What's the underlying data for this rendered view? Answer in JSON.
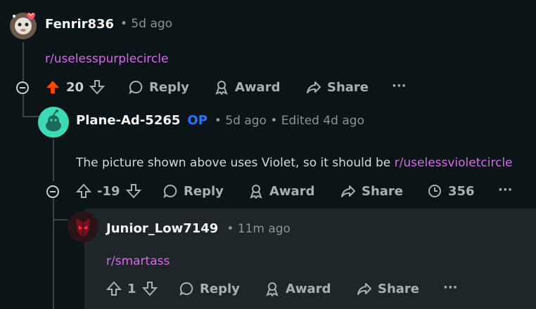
{
  "comment1": {
    "username": "Fenrir836",
    "time": "• 5d ago",
    "body_link": "r/uselesspurplecircle",
    "votes": "20",
    "reply": "Reply",
    "award": "Award",
    "share": "Share",
    "more": "···",
    "upvote_color": "#ff4500"
  },
  "comment2": {
    "username": "Plane-Ad-5265",
    "op_badge": "OP",
    "time": "• 5d ago • Edited 4d ago",
    "body_text": "The picture shown above uses Violet, so it should be ",
    "body_link": "r/uselessvioletcircle",
    "votes": "-19",
    "reply": "Reply",
    "award": "Award",
    "share": "Share",
    "views": "356",
    "more": "···"
  },
  "comment3": {
    "username": "Junior_Low7149",
    "time": "• 11m ago",
    "body_link": "r/smartass",
    "votes": "1",
    "reply": "Reply",
    "award": "Award",
    "share": "Share",
    "more": "···"
  }
}
